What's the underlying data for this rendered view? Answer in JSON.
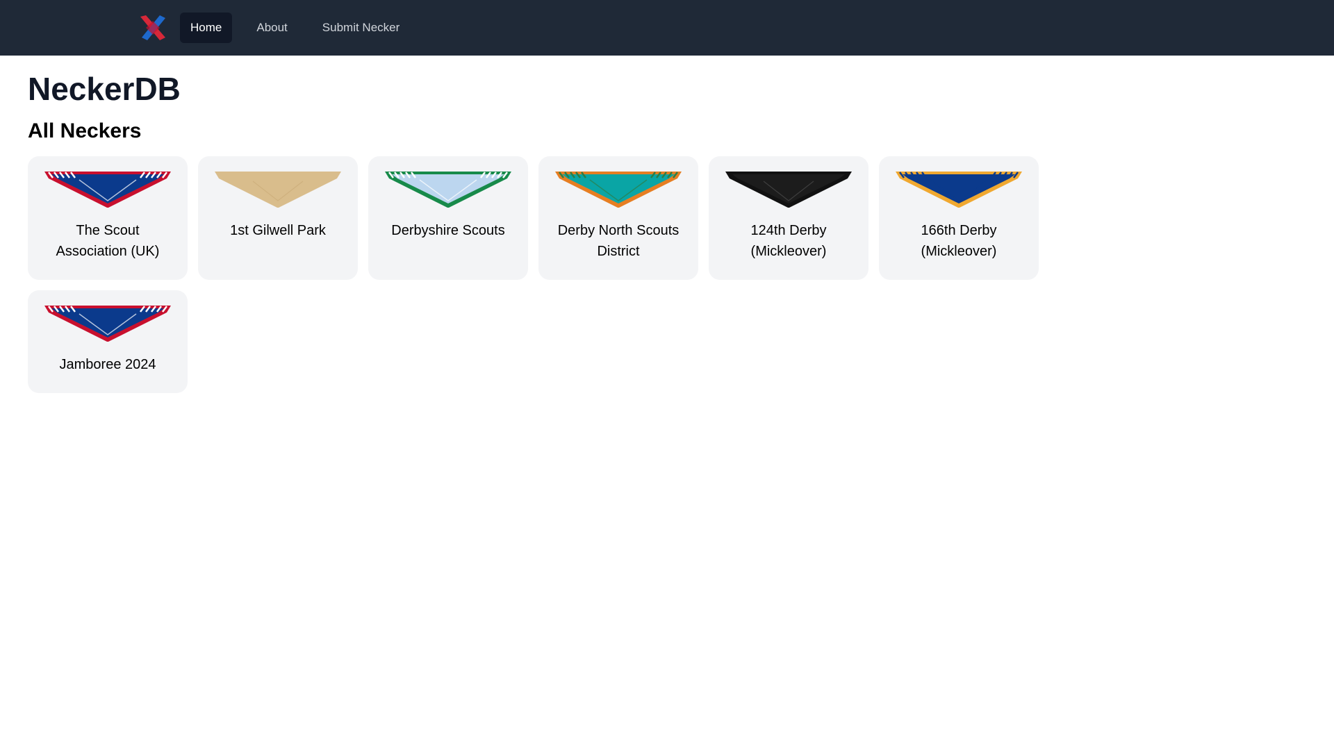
{
  "nav": {
    "logo_icon": "neckerdb-logo-icon",
    "links": [
      {
        "label": "Home",
        "active": true
      },
      {
        "label": "About",
        "active": false
      },
      {
        "label": "Submit Necker",
        "active": false
      }
    ]
  },
  "page": {
    "title": "NeckerDB",
    "subtitle": "All Neckers"
  },
  "neckers": [
    {
      "name": "The Scout Association (UK)",
      "main": "#0b3a8c",
      "edge": "#c8102e",
      "stripe": "#ffffff",
      "striped": true
    },
    {
      "name": "1st Gilwell Park",
      "main": "#d9bd8c",
      "edge": "#d9bd8c",
      "stripe": "#c8a874",
      "striped": false
    },
    {
      "name": "Derbyshire Scouts",
      "main": "#bcd6ef",
      "edge": "#178a4a",
      "stripe": "#ffffff",
      "striped": true
    },
    {
      "name": "Derby North Scouts District",
      "main": "#0aa5a5",
      "edge": "#e67e22",
      "stripe": "#2d7d46",
      "striped": true
    },
    {
      "name": "124th Derby (Mickleover)",
      "main": "#1c1c1c",
      "edge": "#111111",
      "stripe": "#555555",
      "striped": false
    },
    {
      "name": "166th Derby (Mickleover)",
      "main": "#0b3a8c",
      "edge": "#f0a830",
      "stripe": "#0b3a8c",
      "striped": true
    },
    {
      "name": "Jamboree 2024",
      "main": "#0b3a8c",
      "edge": "#c8102e",
      "stripe": "#ffffff",
      "striped": true
    }
  ]
}
